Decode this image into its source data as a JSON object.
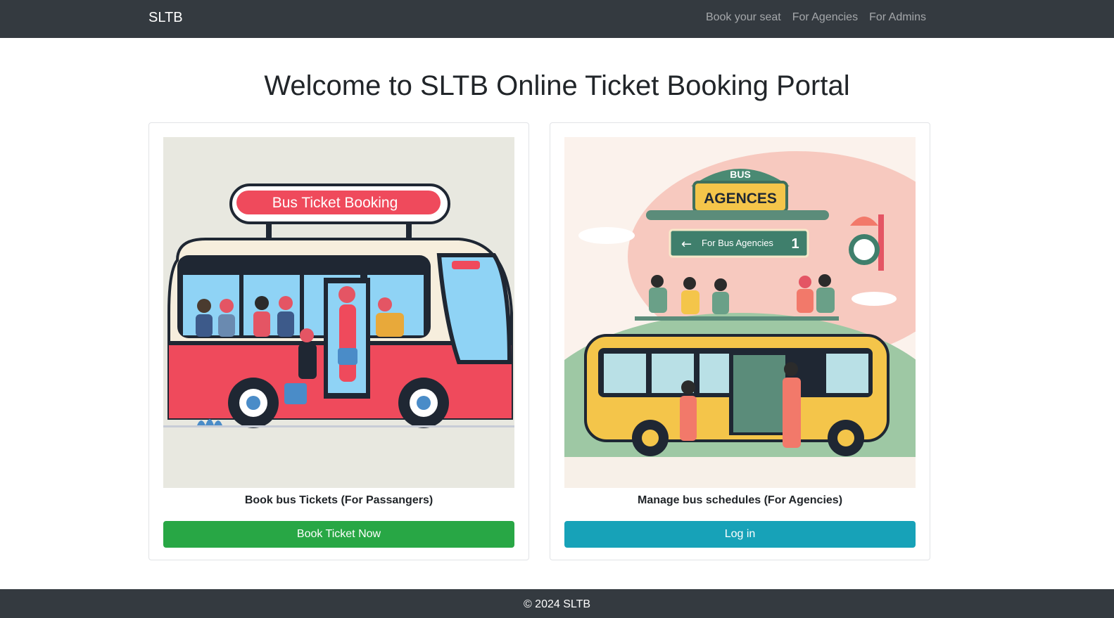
{
  "navbar": {
    "brand": "SLTB",
    "links": [
      "Book your seat",
      "For Agencies",
      "For Admins"
    ]
  },
  "main": {
    "title": "Welcome to SLTB Online Ticket Booking Portal",
    "cards": [
      {
        "image_sign": "Bus Ticket Booking",
        "title": "Book bus Tickets (For Passangers)",
        "button": "Book Ticket Now",
        "button_color": "#28a745"
      },
      {
        "image_sign_top": "BUS",
        "image_sign_main": "AGENCES",
        "image_sign_arrow": "For Bus Agencies",
        "image_sign_number": "1",
        "title": "Manage bus schedules (For Agencies)",
        "button": "Log in",
        "button_color": "#17a2b8"
      }
    ]
  },
  "footer": {
    "text": "© 2024 SLTB"
  },
  "colors": {
    "navbar_bg": "#343a40",
    "footer_bg": "#343a40",
    "success": "#28a745",
    "info": "#17a2b8"
  }
}
